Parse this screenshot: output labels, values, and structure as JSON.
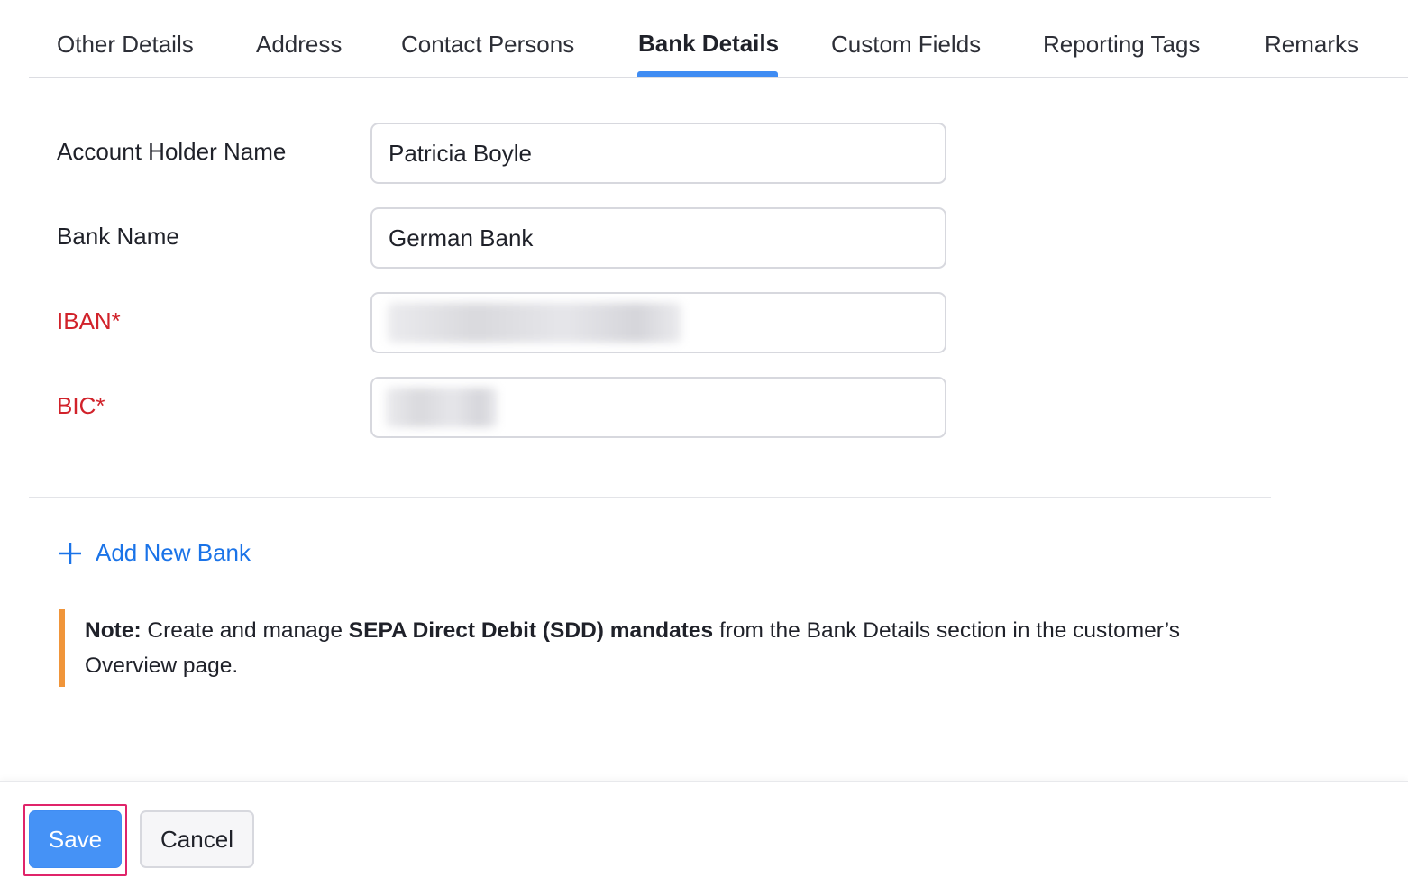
{
  "tabs": [
    {
      "label": "Other Details",
      "active": false
    },
    {
      "label": "Address",
      "active": false
    },
    {
      "label": "Contact Persons",
      "active": false
    },
    {
      "label": "Bank Details",
      "active": true
    },
    {
      "label": "Custom Fields",
      "active": false
    },
    {
      "label": "Reporting Tags",
      "active": false
    },
    {
      "label": "Remarks",
      "active": false
    }
  ],
  "form": {
    "account_holder_label": "Account Holder Name",
    "account_holder_value": "Patricia Boyle",
    "bank_name_label": "Bank Name",
    "bank_name_value": "German Bank",
    "iban_label": "IBAN*",
    "bic_label": "BIC*"
  },
  "add_bank_label": "Add New Bank",
  "note": {
    "prefix": "Note:",
    "text_before": " Create and manage ",
    "bold_text": "SEPA Direct Debit (SDD) mandates",
    "text_after": " from the Bank Details section in the customer’s Overview page."
  },
  "footer": {
    "save_label": "Save",
    "cancel_label": "Cancel"
  },
  "colors": {
    "accent": "#3f8cf3",
    "required": "#d1222a",
    "link": "#1a73e8",
    "note_bar": "#f0953a",
    "highlight": "#e0246a"
  },
  "icons": {
    "add": "plus-icon"
  }
}
